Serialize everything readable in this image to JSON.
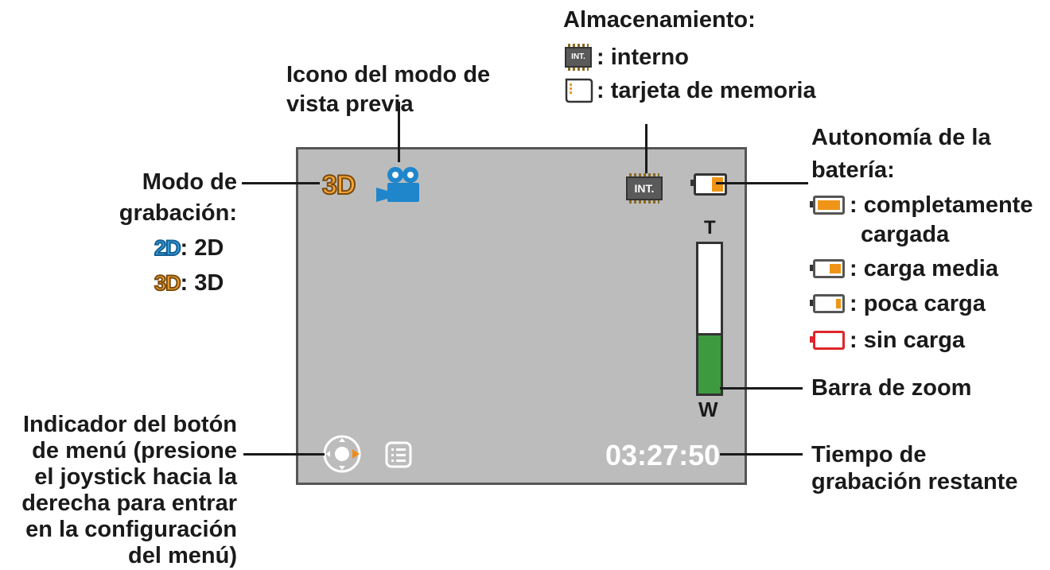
{
  "labels": {
    "modo_grabacion": [
      "Modo de",
      "grabación:"
    ],
    "modo_2d": "2D",
    "modo_2d_value": ": 2D",
    "modo_3d": "3D",
    "modo_3d_value": ": 3D",
    "icono_vista": [
      "Icono del modo de",
      "vista previa"
    ],
    "almacenamiento_title": "Almacenamiento:",
    "int_chip": "INT.",
    "almacenamiento_interno": ": interno",
    "almacenamiento_tarjeta": ": tarjeta de memoria",
    "autonomia": [
      "Autonomía de la",
      "batería:"
    ],
    "bateria_completa": [
      ": completamente",
      "cargada"
    ],
    "bateria_media": ": carga media",
    "bateria_poca": ": poca carga",
    "bateria_sin": ": sin carga",
    "barra_zoom": "Barra de zoom",
    "tiempo": [
      "Tiempo de",
      "grabación restante"
    ],
    "indicador": [
      "Indicador del botón",
      "de menú (presione",
      "el joystick hacia la",
      "derecha para entrar",
      "en la configuración",
      "del menú)"
    ]
  },
  "screen": {
    "mode_badge": "3D",
    "storage_chip": "INT.",
    "zoom_t": "T",
    "zoom_w": "W",
    "zoom_level": 0.39,
    "time_remaining": "03:27:50"
  },
  "colors": {
    "screen_bg": "#bcbcbc",
    "badge_3d": "#f3a536",
    "badge_2d": "#3aa0dc",
    "camera_icon": "#1f86cc",
    "battery_fill": "#f09418",
    "battery_empty": "#e0262a",
    "zoom_fill": "#3d9a3f"
  }
}
